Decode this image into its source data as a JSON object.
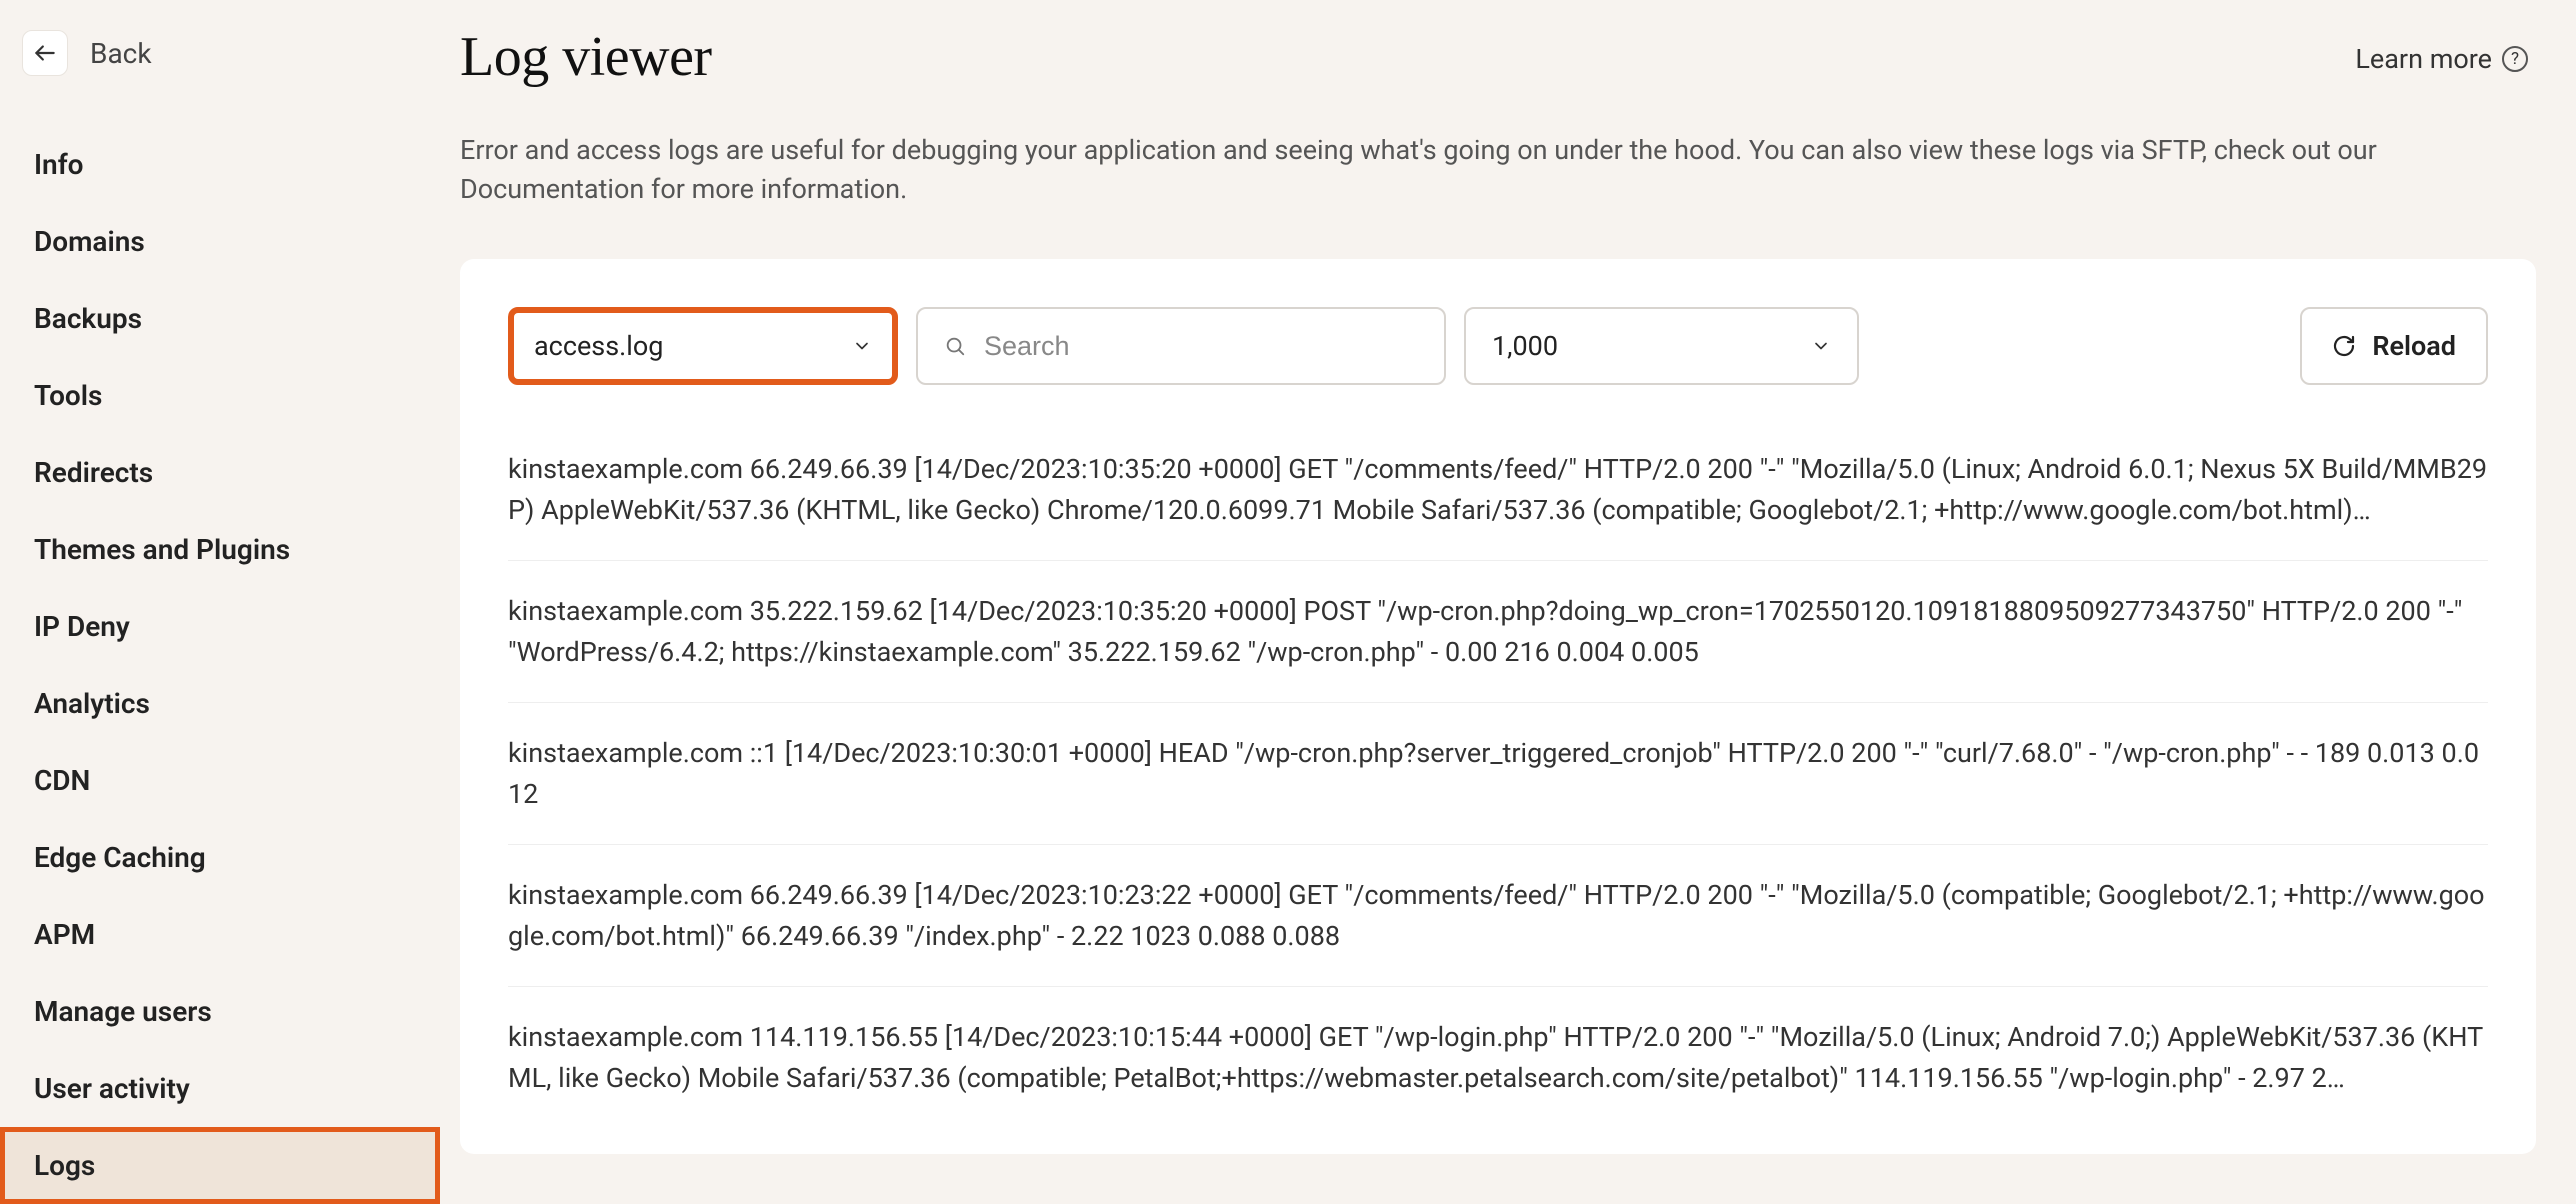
{
  "sidebar": {
    "back_label": "Back",
    "items": [
      {
        "label": "Info"
      },
      {
        "label": "Domains"
      },
      {
        "label": "Backups"
      },
      {
        "label": "Tools"
      },
      {
        "label": "Redirects"
      },
      {
        "label": "Themes and Plugins"
      },
      {
        "label": "IP Deny"
      },
      {
        "label": "Analytics"
      },
      {
        "label": "CDN"
      },
      {
        "label": "Edge Caching"
      },
      {
        "label": "APM"
      },
      {
        "label": "Manage users"
      },
      {
        "label": "User activity"
      },
      {
        "label": "Logs"
      }
    ]
  },
  "header": {
    "title": "Log viewer",
    "learn_more": "Learn more",
    "description": "Error and access logs are useful for debugging your application and seeing what's going on under the hood. You can also view these logs via SFTP, check out our Documentation for more information."
  },
  "controls": {
    "file_selected": "access.log",
    "search_placeholder": "Search",
    "count_selected": "1,000",
    "reload_label": "Reload"
  },
  "logs": [
    "kinstaexample.com 66.249.66.39 [14/Dec/2023:10:35:20 +0000] GET \"/comments/feed/\" HTTP/2.0 200 \"-\" \"Mozilla/5.0 (Linux; Android 6.0.1; Nexus 5X Build/MMB29P) AppleWebKit/537.36 (KHTML, like Gecko) Chrome/120.0.6099.71 Mobile Safari/537.36 (compatible; Googlebot/2.1; +http://www.google.com/bot.html)…",
    "kinstaexample.com 35.222.159.62 [14/Dec/2023:10:35:20 +0000] POST \"/wp-cron.php?doing_wp_cron=1702550120.1091818809509277343750\" HTTP/2.0 200 \"-\" \"WordPress/6.4.2; https://kinstaexample.com\" 35.222.159.62 \"/wp-cron.php\" - 0.00 216 0.004 0.005",
    "kinstaexample.com ::1 [14/Dec/2023:10:30:01 +0000] HEAD \"/wp-cron.php?server_triggered_cronjob\" HTTP/2.0 200 \"-\" \"curl/7.68.0\" - \"/wp-cron.php\" - - 189 0.013 0.012",
    "kinstaexample.com 66.249.66.39 [14/Dec/2023:10:23:22 +0000] GET \"/comments/feed/\" HTTP/2.0 200 \"-\" \"Mozilla/5.0 (compatible; Googlebot/2.1; +http://www.google.com/bot.html)\" 66.249.66.39 \"/index.php\" - 2.22 1023 0.088 0.088",
    "kinstaexample.com 114.119.156.55 [14/Dec/2023:10:15:44 +0000] GET \"/wp-login.php\" HTTP/2.0 200 \"-\" \"Mozilla/5.0 (Linux; Android 7.0;) AppleWebKit/537.36 (KHTML, like Gecko) Mobile Safari/537.36 (compatible; PetalBot;+https://webmaster.petalsearch.com/site/petalbot)\" 114.119.156.55 \"/wp-login.php\" - 2.97 2…"
  ]
}
